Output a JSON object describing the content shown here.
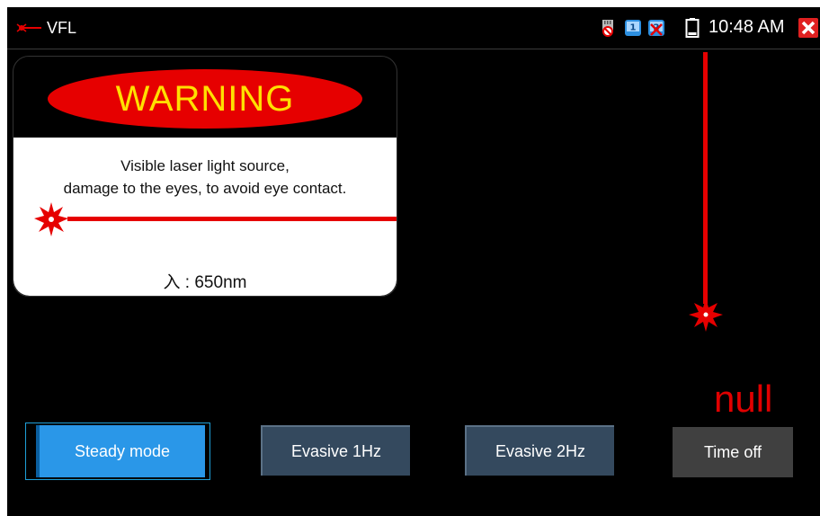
{
  "statusbar": {
    "title": "VFL",
    "time": "10:48 AM"
  },
  "warning": {
    "heading": "WARNING",
    "message_line1": "Visible laser light source,",
    "message_line2": "damage to the eyes, to avoid eye contact.",
    "wavelength": "入 : 650nm"
  },
  "status_value": "null",
  "modes": {
    "steady": "Steady mode",
    "evasive_1hz": "Evasive 1Hz",
    "evasive_2hz": "Evasive 2Hz",
    "time_off": "Time off",
    "selected": "Steady mode"
  },
  "colors": {
    "laser_red": "#e60000",
    "warning_yellow": "#ffe000",
    "selected_button": "#2a97e8",
    "button": "#34495e"
  }
}
